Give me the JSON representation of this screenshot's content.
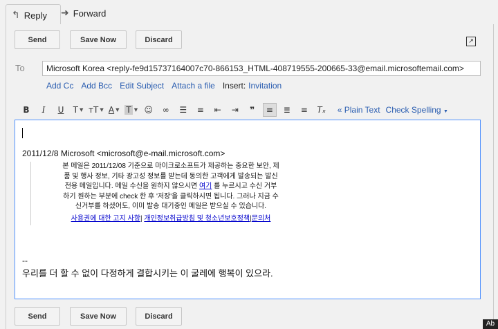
{
  "tabs": {
    "reply": "Reply",
    "forward": "Forward"
  },
  "buttons": {
    "send": "Send",
    "save_now": "Save Now",
    "discard": "Discard"
  },
  "to": {
    "label": "To",
    "value": "Microsoft Korea <reply-fe9d15737164007c70-866153_HTML-408719555-200665-33@email.microsoftemail.com>"
  },
  "compose_links": {
    "add_cc": "Add Cc",
    "add_bcc": "Add Bcc",
    "edit_subject": "Edit Subject",
    "attach_file": "Attach a file",
    "insert_label": "Insert:",
    "invitation": "Invitation"
  },
  "toolbar": {
    "bold": "B",
    "italic": "I",
    "underline": "U",
    "font": "T",
    "size": "тT",
    "text_color": "A",
    "highlight": "T",
    "plain_text": "« Plain Text",
    "check_spelling": "Check Spelling"
  },
  "body": {
    "quote_header": "2011/12/8 Microsoft <microsoft@e-mail.microsoft.com>",
    "quote_lines": [
      "본 메일은 2011/12/08 기준으로 마이크로소프트가 제공하는 중요한 보안, 제",
      "품 및 행사 정보, 기타 광고성 정보를 받는데 동의한 고객에게 발송되는 발신",
      "전용 메일입니다. 메일 수신을 원하지 않으시면",
      "를 누르시고 수신 거부",
      "하기 원하는 부분에 check 한 후 '저장'을 클릭하시면 됩니다. 그러나 지금 수",
      "신거부를 하셨어도, 이미 발송 대기중인 메일은 받으실 수 있습니다."
    ],
    "link_here": "여기",
    "footer_link_1": "사용권에 대한 고지 사항",
    "footer_link_2": "개인정보취급방침 및 청소년보호정책",
    "footer_link_3": "문의처",
    "sep": "|",
    "sig_dash": "--",
    "signature": "우리를 더 할 수 없이 다정하게 결합시키는 이 굴레에 행복이 있으라."
  },
  "corner_badge": "Ab"
}
